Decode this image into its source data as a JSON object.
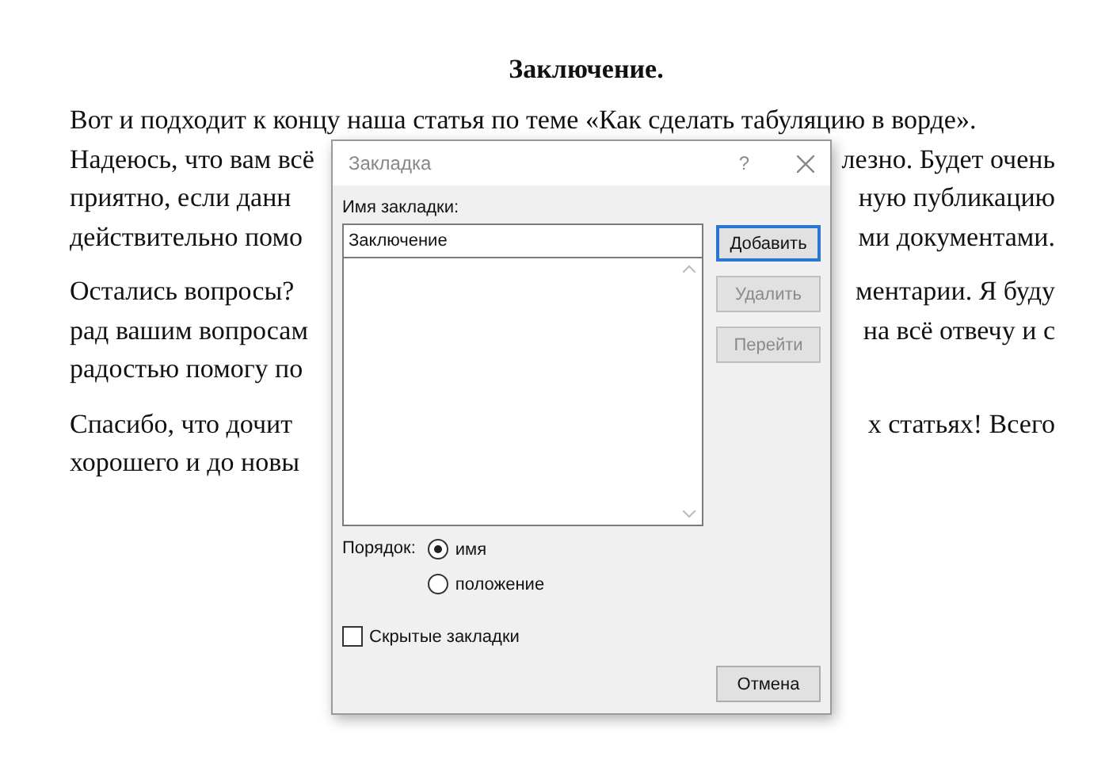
{
  "document": {
    "heading": "Заключение.",
    "paragraphs": [
      {
        "lines": [
          {
            "left": "Вот и подходит к концу наша статья по теме «Как сделать табуляцию в ворде»."
          },
          {
            "left": "Надеюсь, что вам всё",
            "right": "лезно. Будет очень"
          },
          {
            "left": "приятно, если данн",
            "right": "ную публикацию"
          },
          {
            "left": "действительно помо",
            "right": "ми документами."
          }
        ]
      },
      {
        "lines": [
          {
            "left": "Остались вопросы?",
            "right": "ментарии. Я буду"
          },
          {
            "left": "рад вашим вопросам",
            "right": "на всё отвечу и с"
          },
          {
            "left": "радостью помогу по"
          }
        ]
      },
      {
        "lines": [
          {
            "left": "Спасибо, что дочит",
            "right": "х статьях! Всего"
          },
          {
            "left": "хорошего и до новы"
          }
        ]
      }
    ]
  },
  "dialog": {
    "title": "Закладка",
    "help": "?",
    "name_label": "Имя закладки:",
    "name_value": "Заключение",
    "buttons": [
      {
        "label": "Добавить",
        "disabled": false,
        "default": true
      },
      {
        "label": "Удалить",
        "disabled": true,
        "default": false
      },
      {
        "label": "Перейти",
        "disabled": true,
        "default": false
      }
    ],
    "order_label": "Порядок:",
    "order_options": [
      {
        "label": "имя",
        "selected": true
      },
      {
        "label": "положение",
        "selected": false
      }
    ],
    "hidden_bookmarks": {
      "label": "Скрытые закладки",
      "checked": false
    },
    "cancel": "Отмена"
  }
}
